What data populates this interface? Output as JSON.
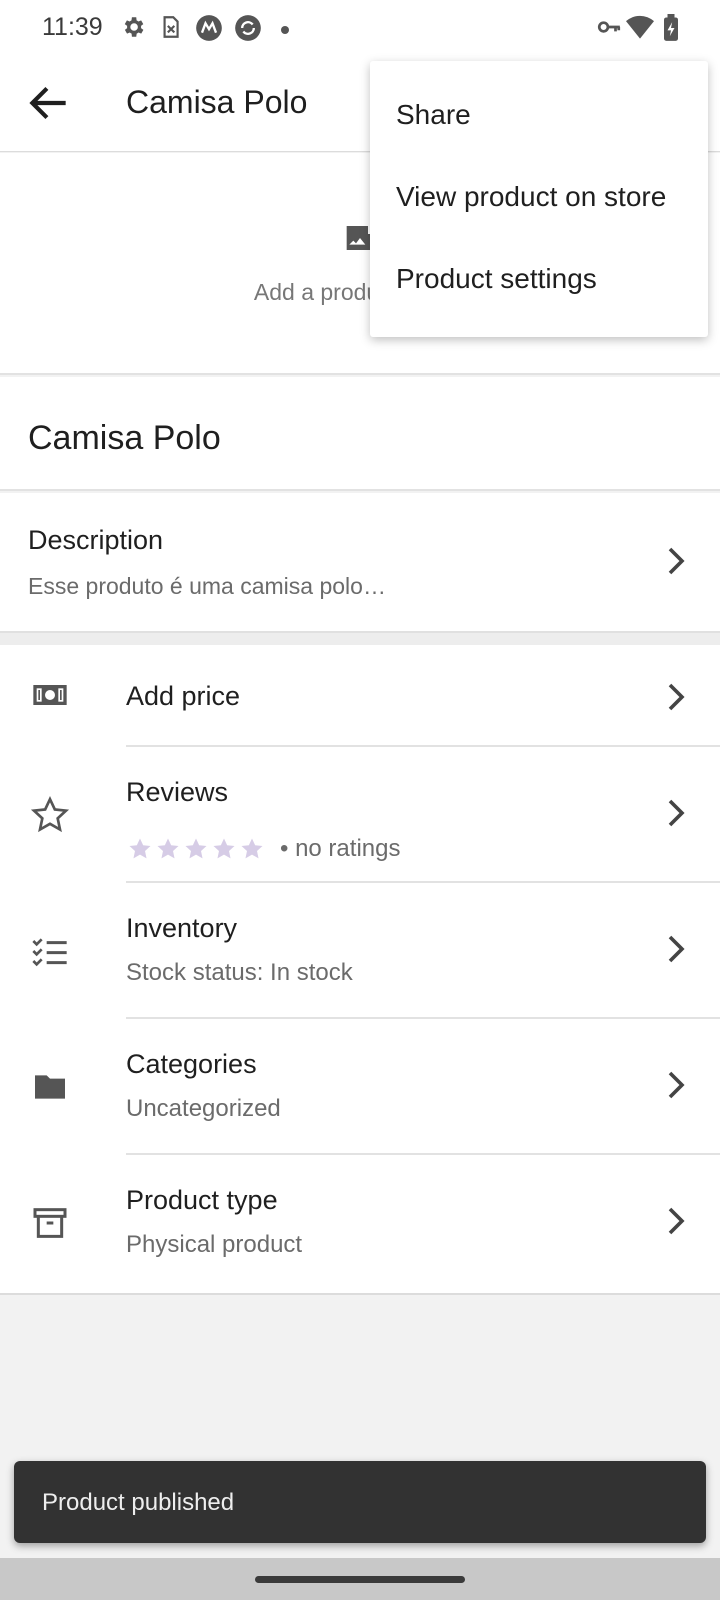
{
  "status_bar": {
    "time": "11:39"
  },
  "app_bar": {
    "title": "Camisa Polo"
  },
  "image_area": {
    "label": "Add a product image"
  },
  "product": {
    "name": "Camisa Polo"
  },
  "description": {
    "title": "Description",
    "text": "Esse produto é uma camisa polo…"
  },
  "rows": {
    "price": {
      "title": "Add price"
    },
    "reviews": {
      "title": "Reviews",
      "rating": 0,
      "rating_text": "• no ratings"
    },
    "inventory": {
      "title": "Inventory",
      "subtitle": "Stock status: In stock"
    },
    "categories": {
      "title": "Categories",
      "subtitle": "Uncategorized"
    },
    "product_type": {
      "title": "Product type",
      "subtitle": "Physical product"
    }
  },
  "overflow_menu": {
    "items": [
      "Share",
      "View product on store",
      "Product settings"
    ]
  },
  "snackbar": {
    "text": "Product published"
  },
  "colors": {
    "star_inactive": "#d6cce6",
    "snackbar_bg": "#323232",
    "icon": "#555555"
  }
}
